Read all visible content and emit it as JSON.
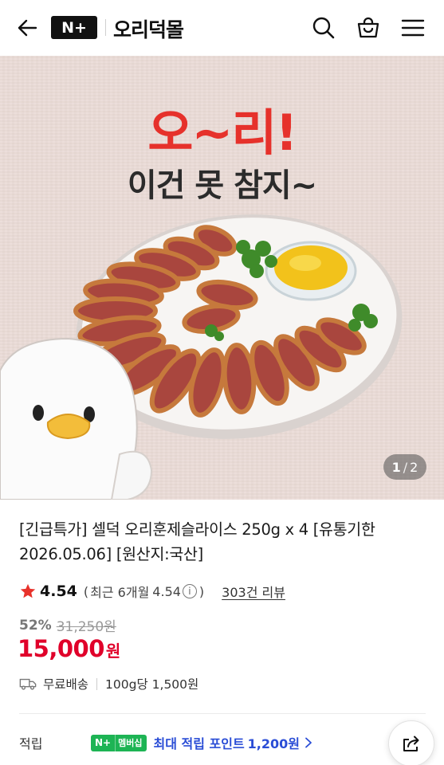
{
  "header": {
    "logo_badge": "N+",
    "brand": "오리덕몰",
    "icons": [
      "back-arrow-icon",
      "search-icon",
      "cart-icon",
      "menu-icon"
    ]
  },
  "hero": {
    "headline": "오~리!",
    "subheadline": "이건 못 참지~",
    "page_current": "1",
    "page_sep": "/",
    "page_total": "2",
    "colors": {
      "headline": "#e6312b",
      "background": "#eadbd6"
    }
  },
  "product": {
    "title": "[긴급특가] 셀덕 오리훈제슬라이스 250g x 4 [유통기한 2026.05.06] [원산지:국산]",
    "rating": "4.54",
    "recent_open": "(",
    "recent_label": "최근 6개월",
    "recent_rating": "4.54",
    "recent_close": ")",
    "review_link": "303건 리뷰",
    "discount": "52%",
    "original_price": "31,250원",
    "price": "15,000",
    "currency": "원",
    "shipping": "무료배송",
    "unit_price": "100g당 1,500원",
    "points_label": "적립",
    "badge_np": "N+",
    "badge_member": "멤버십",
    "points_text": "최대 적립 포인트",
    "points_amount": "1,200원",
    "accent_color": "#e0002a",
    "points_color": "#2a4dd6"
  }
}
